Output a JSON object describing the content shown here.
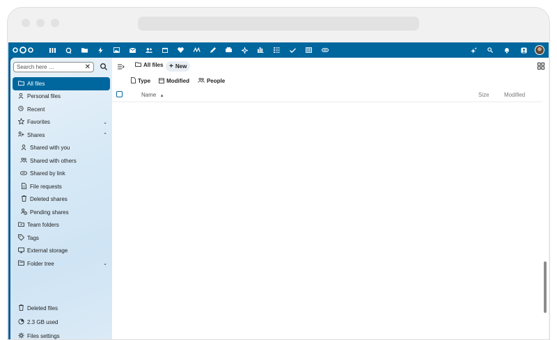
{
  "sidebar": {
    "search_placeholder": "Search here …",
    "items": [
      {
        "label": "All files",
        "icon": "folder-icon",
        "glyph": "▭"
      },
      {
        "label": "Personal files",
        "icon": "person-icon",
        "glyph": "👤"
      },
      {
        "label": "Recent",
        "icon": "history-icon",
        "glyph": "◷"
      },
      {
        "label": "Favorites",
        "icon": "star-icon",
        "glyph": "☆"
      },
      {
        "label": "Shares",
        "icon": "share-icon",
        "glyph": "⧉"
      },
      {
        "label": "Shared with you",
        "icon": "person-icon",
        "glyph": "👤"
      },
      {
        "label": "Shared with others",
        "icon": "group-icon",
        "glyph": "👥"
      },
      {
        "label": "Shared by link",
        "icon": "link-icon",
        "glyph": "⊘"
      },
      {
        "label": "File requests",
        "icon": "file-icon",
        "glyph": "🗋"
      },
      {
        "label": "Deleted shares",
        "icon": "trash-icon",
        "glyph": "🗑"
      },
      {
        "label": "Pending shares",
        "icon": "pending-icon",
        "glyph": "⧗"
      },
      {
        "label": "Team folders",
        "icon": "team-folder-icon",
        "glyph": "▭"
      },
      {
        "label": "Tags",
        "icon": "tag-icon",
        "glyph": "⌂"
      },
      {
        "label": "External storage",
        "icon": "monitor-icon",
        "glyph": "▭"
      },
      {
        "label": "Folder tree",
        "icon": "folder-tree-icon",
        "glyph": "▭"
      }
    ],
    "bottom": [
      {
        "label": "Deleted files",
        "icon": "trash-icon",
        "glyph": "🗑"
      },
      {
        "label": "2.3 GB used",
        "icon": "pie-chart-icon",
        "glyph": "◔"
      },
      {
        "label": "Files settings",
        "icon": "gear-icon",
        "glyph": "⚙"
      }
    ]
  },
  "topbar": {
    "apps": [
      "dashboard-icon",
      "talk-icon",
      "files-icon",
      "activity-icon",
      "photos-icon",
      "mail-icon",
      "contacts-icon",
      "calendar-icon",
      "heart-icon",
      "whiteboard-icon",
      "pen-icon",
      "deck-icon",
      "star-sparkle-icon",
      "analytics-icon",
      "tasks-icon",
      "check-icon",
      "tables-icon",
      "link-icon"
    ],
    "accent": "#00679e"
  },
  "main": {
    "breadcrumb_label": "All files",
    "new_label": "New",
    "filters": [
      {
        "label": "Type",
        "icon": "file-icon"
      },
      {
        "label": "Modified",
        "icon": "calendar-icon"
      },
      {
        "label": "People",
        "icon": "group-icon"
      }
    ],
    "columns": {
      "name": "Name",
      "size": "Size",
      "modified": "Modified"
    }
  }
}
